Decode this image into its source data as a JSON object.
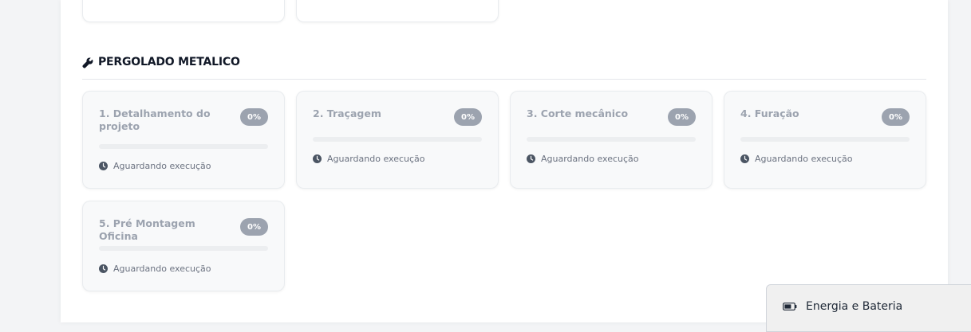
{
  "section": {
    "title": "PERGOLADO METALICO",
    "icon": "wrench-icon"
  },
  "steps": [
    {
      "title": "1. Detalhamento do projeto",
      "percent_label": "0%",
      "progress": 0,
      "status": "Aguardando execução"
    },
    {
      "title": "2. Traçagem",
      "percent_label": "0%",
      "progress": 0,
      "status": "Aguardando execução"
    },
    {
      "title": "3. Corte mecânico",
      "percent_label": "0%",
      "progress": 0,
      "status": "Aguardando execução"
    },
    {
      "title": "4. Furação",
      "percent_label": "0%",
      "progress": 0,
      "status": "Aguardando execução"
    },
    {
      "title": "5. Pré Montagem Oficina",
      "percent_label": "0%",
      "progress": 0,
      "status": "Aguardando execução"
    }
  ],
  "notification": {
    "label": "Energia e Bateria",
    "icon": "battery-icon"
  },
  "colors": {
    "badge": "#9ca3af",
    "muted_text": "#9ca3af",
    "card_bg": "#f8f9fa"
  }
}
